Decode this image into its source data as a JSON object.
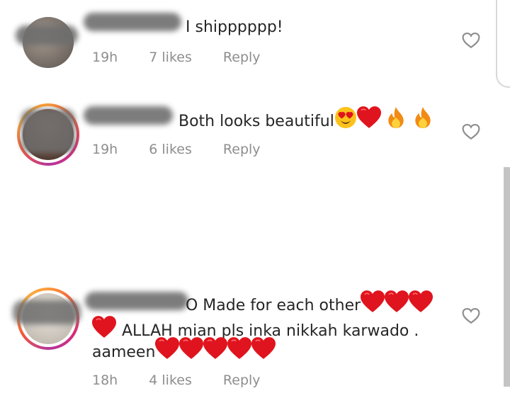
{
  "comments": [
    {
      "text": "I shipppppp!",
      "time": "19h",
      "likes": "7 likes",
      "reply": "Reply",
      "has_story_ring": false
    },
    {
      "text": "Both looks beautiful",
      "emojis": [
        "heart-eyes-emoji",
        "red-heart-emoji",
        "fire-emoji",
        "fire-emoji"
      ],
      "time": "19h",
      "likes": "6 likes",
      "reply": "Reply",
      "has_story_ring": true
    },
    {
      "text_line1": "O Made for each other",
      "text_line2": "ALLAH mian  pls inka nikkah karwado .",
      "text_line3": "aameen",
      "emojis_line1": [
        "red-heart-emoji",
        "red-heart-emoji",
        "red-heart-emoji"
      ],
      "emojis_line2_prefix": [
        "red-heart-emoji"
      ],
      "emojis_line3": [
        "red-heart-emoji",
        "red-heart-emoji",
        "red-heart-emoji",
        "red-heart-emoji",
        "red-heart-emoji"
      ],
      "time": "18h",
      "likes": "4 likes",
      "reply": "Reply",
      "has_story_ring": true
    }
  ],
  "icons": {
    "like": "heart-outline-icon"
  },
  "colors": {
    "text": "#262626",
    "meta": "#8e8e8e",
    "heart": "#e0141e",
    "ring_gradient": [
      "#fd9a3a",
      "#f4573b",
      "#d62a7a",
      "#b5359b"
    ]
  }
}
